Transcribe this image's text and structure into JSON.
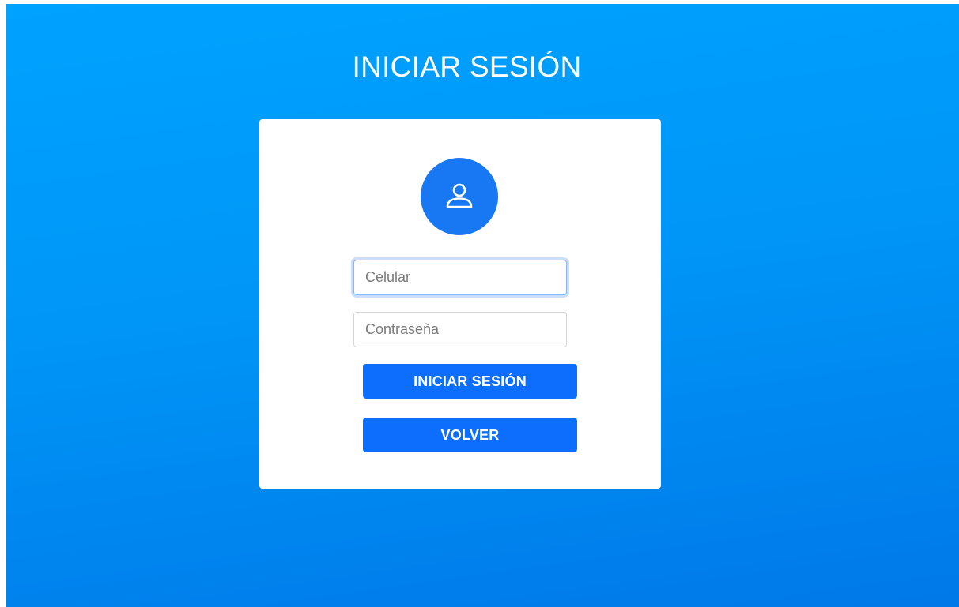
{
  "page": {
    "title": "INICIAR SESIÓN"
  },
  "login_card": {
    "avatar_icon": "user-icon",
    "phone_field": {
      "value": "",
      "placeholder": "Celular"
    },
    "password_field": {
      "value": "",
      "placeholder": "Contraseña"
    },
    "login_button_label": "INICIAR SESIÓN",
    "back_button_label": "VOLVER"
  },
  "colors": {
    "background_top": "#00a2ff",
    "background_bottom": "#0078e8",
    "accent": "#0d6efd",
    "avatar": "#1877f2"
  }
}
